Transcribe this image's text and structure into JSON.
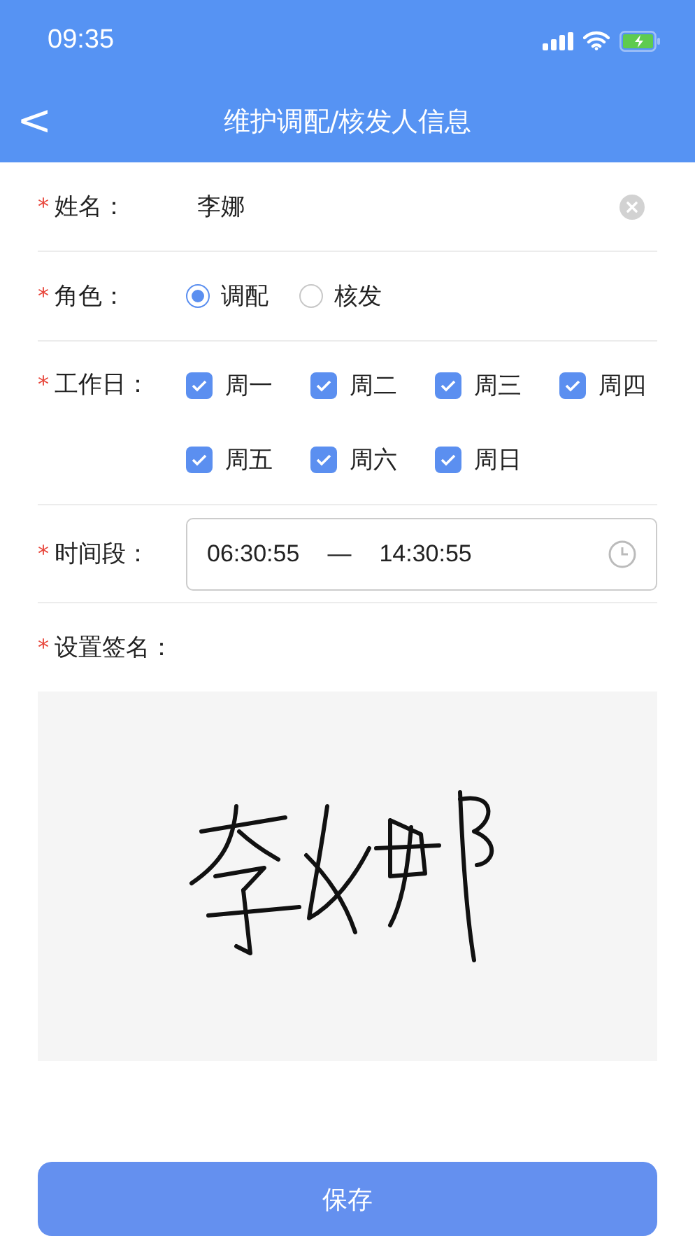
{
  "status_bar": {
    "time": "09:35"
  },
  "header": {
    "back": "<",
    "title": "维护调配/核发人信息"
  },
  "name_field": {
    "label": "姓名：",
    "required": "*",
    "value": "李娜"
  },
  "role": {
    "label": "角色：",
    "required": "*",
    "options": [
      {
        "label": "调配",
        "selected": true
      },
      {
        "label": "核发",
        "selected": false
      }
    ]
  },
  "workdays": {
    "label": "工作日：",
    "required": "*",
    "days": [
      {
        "label": "周一",
        "checked": true
      },
      {
        "label": "周二",
        "checked": true
      },
      {
        "label": "周三",
        "checked": true
      },
      {
        "label": "周四",
        "checked": true
      },
      {
        "label": "周五",
        "checked": true
      },
      {
        "label": "周六",
        "checked": true
      },
      {
        "label": "周日",
        "checked": true
      }
    ]
  },
  "time_range": {
    "label": "时间段：",
    "required": "*",
    "start": "06:30:55",
    "separator": "—",
    "end": "14:30:55"
  },
  "signature": {
    "label": "设置签名：",
    "required": "*"
  },
  "save_button": "保存"
}
